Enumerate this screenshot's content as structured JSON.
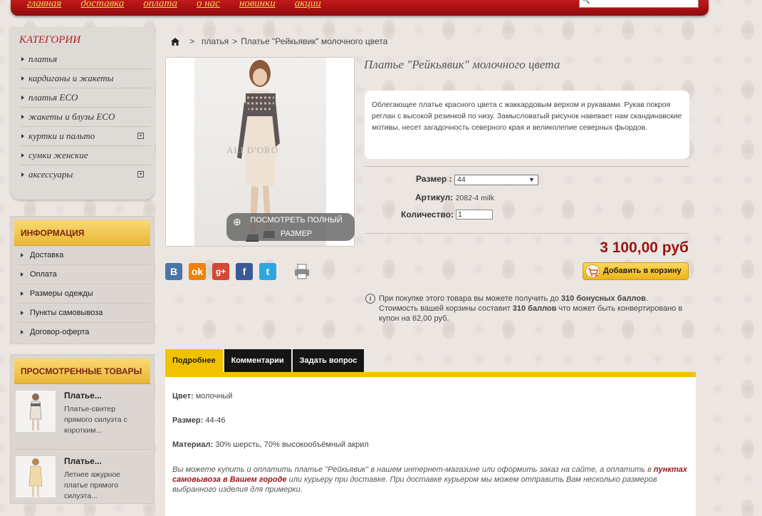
{
  "nav": [
    "главная",
    "доставка",
    "оплата",
    "о нас",
    "новинки",
    "акции"
  ],
  "categories": {
    "title": "КАТЕГОРИИ",
    "items": [
      {
        "label": "платья",
        "expandable": false
      },
      {
        "label": "кардиганы и жакеты",
        "expandable": false
      },
      {
        "label": "платья ECO",
        "expandable": false
      },
      {
        "label": "жакеты и блузы ECO",
        "expandable": false
      },
      {
        "label": "куртки и пальто",
        "expandable": true
      },
      {
        "label": "сумки женские",
        "expandable": false
      },
      {
        "label": "аксессуары",
        "expandable": true
      }
    ],
    "plus": "+"
  },
  "info": {
    "title": "ИНФОРМАЦИЯ",
    "items": [
      "Доставка",
      "Оплата",
      "Размеры одежды",
      "Пункты самовывоза",
      "Договор-оферта"
    ]
  },
  "viewed": {
    "title": "ПРОСМОТРЕННЫЕ ТОВАРЫ",
    "items": [
      {
        "title": "Платье...",
        "desc": "Платье-свитер прямого силуэта с коротким..."
      },
      {
        "title": "Платье...",
        "desc": "Летнее ажурное платье прямого силуэта..."
      }
    ]
  },
  "breadcrumb": {
    "sep": ">",
    "category": "платья",
    "current": "Платье \"Рейкьявик\" молочного цвета"
  },
  "product": {
    "title": "Платье \"Рейкьявик\" молочного цвета",
    "image_watermark": "ALI D'ORO",
    "fullview_label": "ПОСМОТРЕТЬ ПОЛНЫЙ РАЗМЕР",
    "description": "Облегающее платье красного цвета с жаккардовым верхом и рукавами. Рукав покроя реглан с высокой резинкой по низу. Замысловатый рисунок навевает нам скандинавские мотивы, несет загадочность северного края и великолепие северных фьордов.",
    "size_label": "Размер :",
    "size_value": "44",
    "sku_label": "Артикул:",
    "sku_value": "2082-4 milk",
    "qty_label": "Количество:",
    "qty_value": "1",
    "price": "3 100,00 руб",
    "add_to_cart": "Добавить в корзину"
  },
  "social": [
    "B",
    "ok",
    "g+",
    "f",
    "t"
  ],
  "bonus": {
    "line1_pre": "При покупке этого товара вы можете получить до ",
    "line1_bold": "310 бонусных баллов",
    "line1_post": ".",
    "line2_pre": "Стоимость вашей корзины составит ",
    "line2_bold": "310 баллов",
    "line2_post": " что может быть конвертировано в купон на 62,00 руб."
  },
  "tabs": [
    "Подробнее",
    "Комментарии",
    "Задать вопрос"
  ],
  "details": {
    "color_label": "Цвет:",
    "color_value": " молочный",
    "size_label": "Размер:",
    "size_value": " 44-46",
    "material_label": "Материал:",
    "material_value": " 30% шерсть, 70% высокообъёмный акрил",
    "note_pre": "Вы можете купить и оплатить платье \"Рейкьявик\" в нашем интернет-магазине или оформить заказ на сайте, а оплатить в ",
    "note_link": "пунктах самовывоза в Вашем городе",
    "note_post": " или курьеру при доставке. При доставке курьером мы можем отправить Вам несколько размеров выбранного изделия для примерки."
  },
  "colors": {
    "brand_red": "#b51d1d",
    "price_red": "#9a1414",
    "gold": "#f2c200"
  }
}
